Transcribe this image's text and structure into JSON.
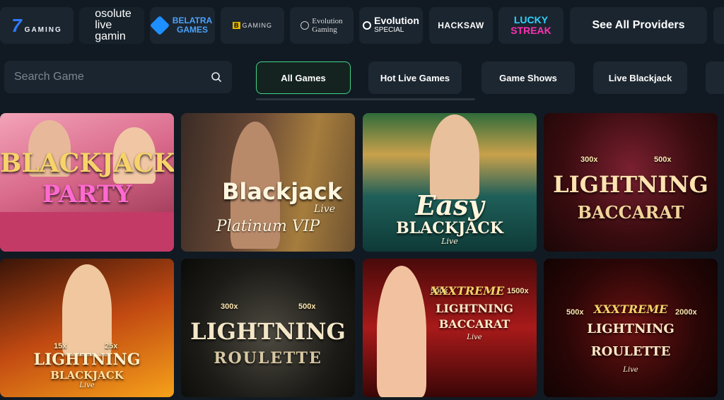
{
  "providers": [
    {
      "name": "7 GAMING",
      "mark": "7",
      "word": "GAMING"
    },
    {
      "name": "Absolute Live Gaming",
      "lines": [
        "osolute",
        "live",
        "gamin"
      ]
    },
    {
      "name": "Belatra Games",
      "lines": [
        "BELATRA",
        "GAMES"
      ]
    },
    {
      "name": "BGaming",
      "mark": "B",
      "word": "GAMING"
    },
    {
      "name": "Evolution Gaming",
      "lines": [
        "Evolution",
        "Gaming"
      ]
    },
    {
      "name": "Evolution Special",
      "lines": [
        "Evolution",
        "SPECIAL"
      ]
    },
    {
      "name": "Hacksaw Gaming",
      "word": "HACKSAW"
    },
    {
      "name": "Lucky Streak",
      "lines": [
        "LUCKY",
        "STREAK"
      ]
    }
  ],
  "see_all_label": "See All Providers",
  "search": {
    "placeholder": "Search Game"
  },
  "tabs": [
    {
      "label": "All Games",
      "active": true
    },
    {
      "label": "Hot Live Games",
      "active": false
    },
    {
      "label": "Game Shows",
      "active": false
    },
    {
      "label": "Live Blackjack",
      "active": false
    }
  ],
  "games": [
    {
      "title": "BLACKJACK",
      "sub": "PARTY"
    },
    {
      "title": "Blackjack",
      "sub": "Live",
      "extra": "Platinum VIP"
    },
    {
      "title": "Easy",
      "sub": "BLACKJACK",
      "extra": "Live"
    },
    {
      "title": "LIGHTNING",
      "sub": "BACCARAT",
      "mult": [
        "300x",
        "500x"
      ]
    },
    {
      "title": "LIGHTNING",
      "sub": "BLACKJACK",
      "extra": "Live",
      "mult": [
        "15x",
        "25x"
      ]
    },
    {
      "title": "LIGHTNING",
      "sub": "ROULETTE",
      "mult": [
        "300x",
        "500x"
      ]
    },
    {
      "title": "XXXTREME",
      "sub": "LIGHTNING BACCARAT",
      "extra": "Live",
      "mult": [
        "500x",
        "1500x"
      ]
    },
    {
      "title": "XXXTREME",
      "sub": "LIGHTNING ROULETTE",
      "extra": "Live",
      "mult": [
        "500x",
        "2000x"
      ]
    }
  ],
  "colors": {
    "accent": "#3fd68a",
    "panel": "#1b252f",
    "background": "#111a22"
  }
}
